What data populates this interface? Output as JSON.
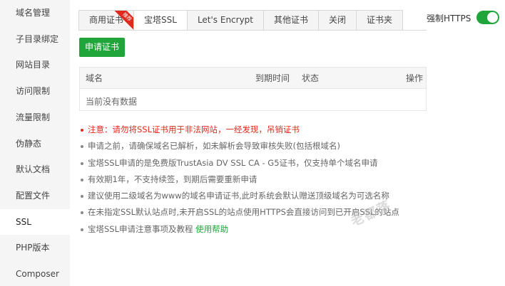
{
  "sidebar": {
    "items": [
      {
        "label": "域名管理"
      },
      {
        "label": "子目录绑定"
      },
      {
        "label": "网站目录"
      },
      {
        "label": "访问限制"
      },
      {
        "label": "流量限制"
      },
      {
        "label": "伪静态"
      },
      {
        "label": "默认文档"
      },
      {
        "label": "配置文件"
      },
      {
        "label": "SSL",
        "active": true
      },
      {
        "label": "PHP版本"
      },
      {
        "label": "Composer"
      }
    ]
  },
  "tabs": [
    {
      "label": "商用证书",
      "badge": "推荐"
    },
    {
      "label": "宝塔SSL",
      "active": true
    },
    {
      "label": "Let's Encrypt"
    },
    {
      "label": "其他证书"
    },
    {
      "label": "关闭"
    },
    {
      "label": "证书夹"
    }
  ],
  "https_toggle": {
    "label": "强制HTTPS",
    "on": true
  },
  "apply_button": {
    "label": "申请证书"
  },
  "table": {
    "columns": [
      "域名",
      "到期时间",
      "状态",
      "操作"
    ],
    "empty_text": "当前没有数据"
  },
  "notes": {
    "warning": "注意：请勿将SSL证书用于非法网站，一经发现，吊销证书",
    "n1": "申请之前，请确保域名已解析，如未解析会导致审核失败(包括根域名)",
    "n2": "宝塔SSL申请的是免费版TrustAsia DV SSL CA - G5证书，仅支持单个域名申请",
    "n3": "有效期1年，不支持续签，到期后需要重新申请",
    "n4": "建议使用二级域名为www的域名申请证书,此时系统会默认赠送顶级域名为可选名称",
    "n5": "在未指定SSL默认站点时,未开启SSL的站点使用HTTPS会直接访问到已开启SSL的站点",
    "n6": "宝塔SSL申请注意事项及教程",
    "help_link": "使用帮助"
  },
  "watermark": "老都落",
  "colors": {
    "accent": "#20a53a",
    "warning": "#e1281c",
    "badge": "#e1281c"
  }
}
